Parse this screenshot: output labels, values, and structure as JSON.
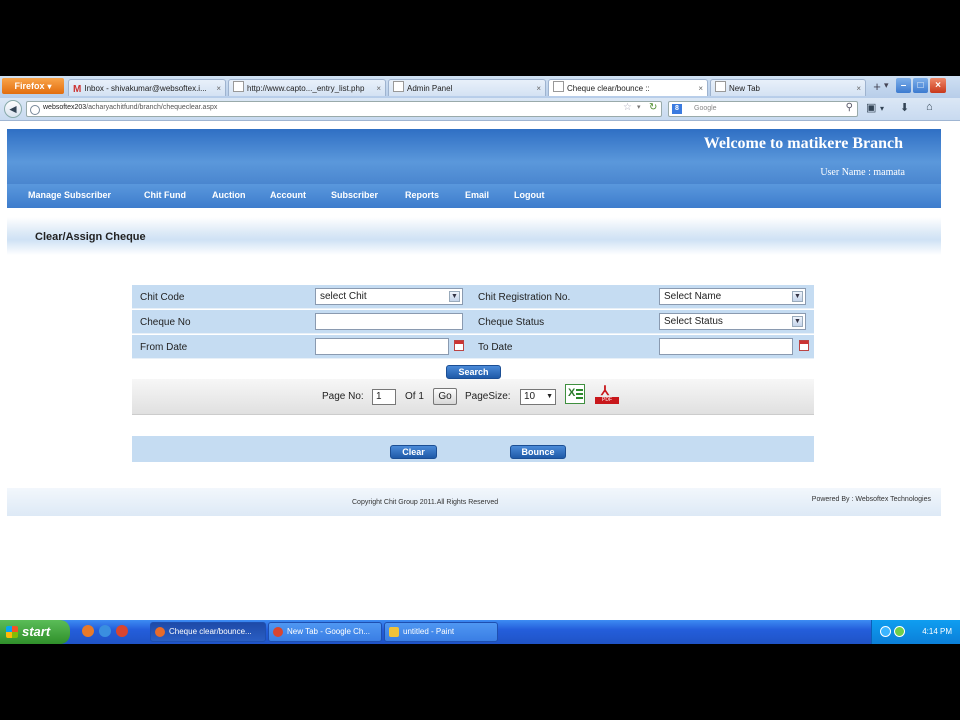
{
  "browser": {
    "app_button": "Firefox",
    "tabs": [
      {
        "label": "Inbox - shivakumar@websoftex.i...",
        "icon": "M",
        "active": false
      },
      {
        "label": "http://www.capto..._entry_list.php",
        "active": false
      },
      {
        "label": "Admin Panel",
        "active": false
      },
      {
        "label": "Cheque clear/bounce ::",
        "active": true
      },
      {
        "label": "New Tab",
        "active": false
      }
    ],
    "url_host": "websoftex203",
    "url_path": "/acharyachitfund/branch/chequeclear.aspx",
    "search_placeholder": "Google",
    "search_engine_icon": "8"
  },
  "site": {
    "welcome": "Welcome to matikere Branch",
    "username": "User Name : mamata",
    "menu": [
      "Manage Subscriber",
      "Chit Fund",
      "Auction",
      "Account",
      "Subscriber",
      "Reports",
      "Email",
      "Logout"
    ],
    "page_title": "Clear/Assign Cheque"
  },
  "form": {
    "chit_code_label": "Chit Code",
    "chit_code_value": "select Chit",
    "chit_reg_label": "Chit Registration No.",
    "chit_reg_value": "Select Name",
    "cheque_no_label": "Cheque No",
    "cheque_no_value": "",
    "cheque_status_label": "Cheque Status",
    "cheque_status_value": "Select Status",
    "from_date_label": "From Date",
    "from_date_value": "",
    "to_date_label": "To Date",
    "to_date_value": "",
    "search_button": "Search"
  },
  "pager": {
    "page_no_label": "Page No:",
    "page_no_value": "1",
    "of_label": "Of 1",
    "go_button": "Go",
    "page_size_label": "PageSize:",
    "page_size_value": "10",
    "pdf_label": "PDF"
  },
  "actions": {
    "clear_button": "Clear",
    "bounce_button": "Bounce"
  },
  "footer": {
    "copyright": "Copyright Chit Group 2011.All Rights Reserved",
    "powered_by": "Powered By : Websoftex Technologies"
  },
  "taskbar": {
    "start": "start",
    "tasks": [
      {
        "label": "Cheque clear/bounce...",
        "active": true
      },
      {
        "label": "New Tab - Google Ch...",
        "active": false
      },
      {
        "label": "untitled - Paint",
        "active": false
      }
    ],
    "clock": "4:14 PM"
  },
  "colors": {
    "header_blue": "#3d7ccc",
    "form_cell": "#c5dcf2",
    "button_blue": "#1f5aa8",
    "taskbar_blue": "#245edb",
    "start_green": "#2f8f2a"
  }
}
